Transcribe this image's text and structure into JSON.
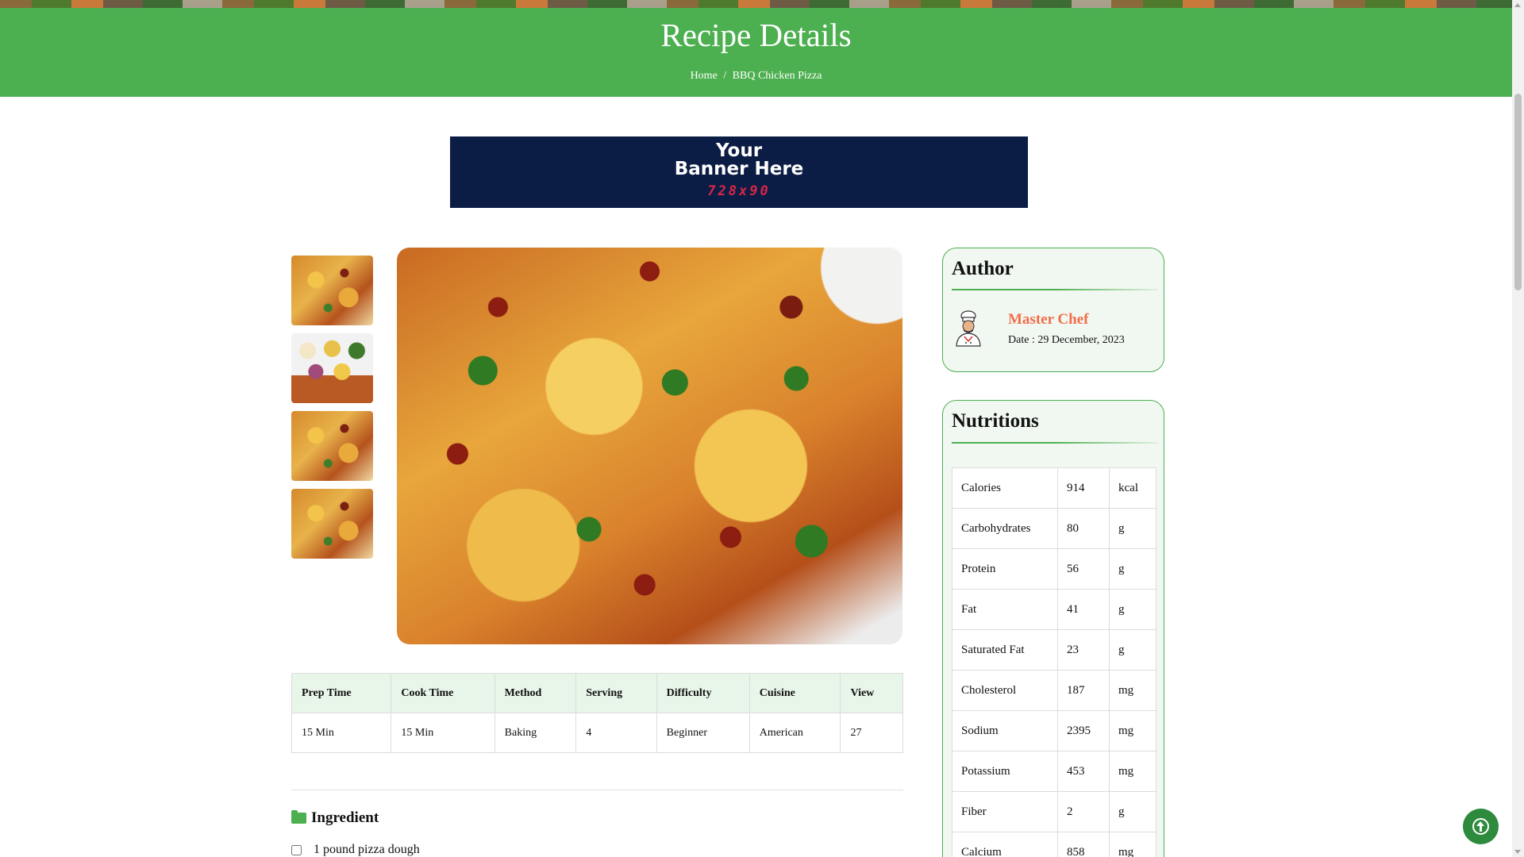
{
  "hero": {
    "title": "Recipe Details",
    "breadcrumb": {
      "home": "Home",
      "separator": "/",
      "current": "BBQ Chicken Pizza"
    }
  },
  "banner": {
    "line1": "Your",
    "line2": "Banner Here",
    "size": "728x90"
  },
  "gallery": {
    "thumbnails": [
      "pizza-slices",
      "ingredients-bowls",
      "pizza-slices",
      "pizza-slices"
    ],
    "main_image": "bbq-chicken-pizza"
  },
  "info_table": {
    "headers": [
      "Prep Time",
      "Cook Time",
      "Method",
      "Serving",
      "Difficulty",
      "Cuisine",
      "View"
    ],
    "values": [
      "15 Min",
      "15 Min",
      "Baking",
      "4",
      "Beginner",
      "American",
      "27"
    ]
  },
  "ingredient": {
    "heading": "Ingredient",
    "items": [
      "1 pound pizza dough"
    ]
  },
  "author": {
    "heading": "Author",
    "name": "Master Chef",
    "date": "Date : 29 December, 2023"
  },
  "nutritions": {
    "heading": "Nutritions",
    "rows": [
      [
        "Calories",
        "914",
        "kcal"
      ],
      [
        "Carbohydrates",
        "80",
        "g"
      ],
      [
        "Protein",
        "56",
        "g"
      ],
      [
        "Fat",
        "41",
        "g"
      ],
      [
        "Saturated Fat",
        "23",
        "g"
      ],
      [
        "Cholesterol",
        "187",
        "mg"
      ],
      [
        "Sodium",
        "2395",
        "mg"
      ],
      [
        "Potassium",
        "453",
        "mg"
      ],
      [
        "Fiber",
        "2",
        "g"
      ],
      [
        "Calcium",
        "858",
        "mg"
      ]
    ]
  },
  "colors": {
    "accent": "#4caf50",
    "author_name": "#f26d4a",
    "banner_bg": "#0c1d45",
    "banner_size": "#d7264a"
  },
  "icons": {
    "folder": "folder-icon",
    "back_to_top": "arrow-up-circle-icon",
    "avatar": "chef-avatar-icon"
  }
}
